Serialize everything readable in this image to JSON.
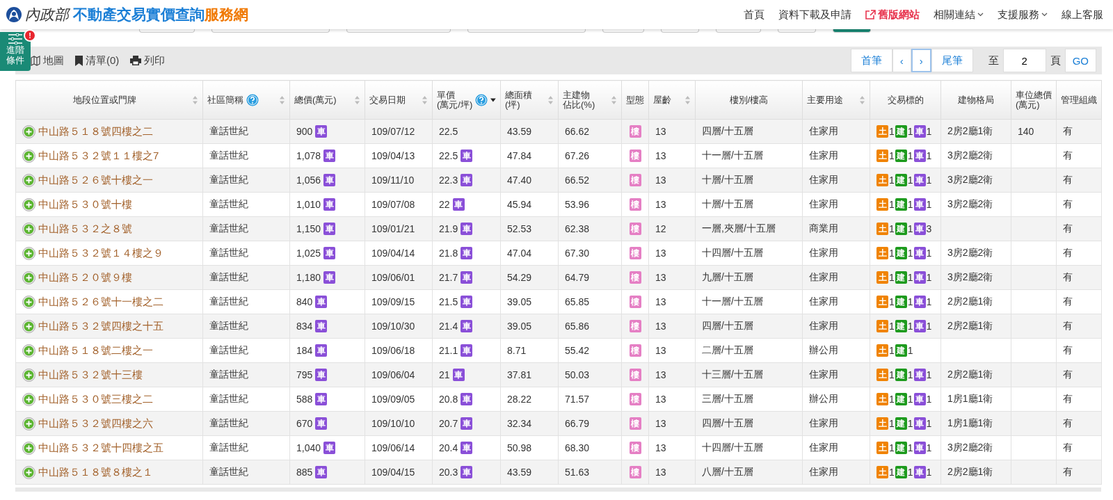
{
  "header": {
    "ministry": "內政部",
    "site_title": "不動產交易實價查詢",
    "site_title_accent": "服務網",
    "nav": [
      {
        "label": "首頁",
        "kind": "plain"
      },
      {
        "label": "資料下載及申請",
        "kind": "plain"
      },
      {
        "label": "舊版網站",
        "kind": "external"
      },
      {
        "label": "相關連結",
        "kind": "dropdown"
      },
      {
        "label": "支援服務",
        "kind": "dropdown"
      },
      {
        "label": "線上客服",
        "kind": "plain"
      }
    ]
  },
  "advanced_tab": {
    "label": "進階條件",
    "alert": "!"
  },
  "toolbar": {
    "actions": [
      {
        "label": "地圖",
        "kind": "map"
      },
      {
        "label": "清單(0)",
        "kind": "bookmark"
      },
      {
        "label": "列印",
        "kind": "print"
      }
    ],
    "pager": {
      "first": "首筆",
      "prev": "‹",
      "next": "›",
      "last": "尾筆",
      "to": "至",
      "page": "2",
      "page_unit": "頁",
      "go": "GO"
    }
  },
  "table": {
    "columns": [
      {
        "label_lines": [
          "地段位置或門牌"
        ],
        "sortable": true,
        "sorted_desc": false,
        "help": false
      },
      {
        "label_lines": [
          "社區簡稱"
        ],
        "sortable": true,
        "sorted_desc": false,
        "help": true
      },
      {
        "label_lines": [
          "總價(萬元)"
        ],
        "sortable": true,
        "sorted_desc": false,
        "help": false
      },
      {
        "label_lines": [
          "交易日期"
        ],
        "sortable": true,
        "sorted_desc": false,
        "help": false
      },
      {
        "label_lines": [
          "單價",
          "(萬元/坪)"
        ],
        "sortable": true,
        "sorted_desc": true,
        "help": true
      },
      {
        "label_lines": [
          "總面積",
          "(坪)"
        ],
        "sortable": true,
        "sorted_desc": false,
        "help": false
      },
      {
        "label_lines": [
          "主建物",
          "佔比(%)"
        ],
        "sortable": true,
        "sorted_desc": false,
        "help": false
      },
      {
        "label_lines": [
          "型態"
        ],
        "sortable": false,
        "help": false
      },
      {
        "label_lines": [
          "屋齡"
        ],
        "sortable": true,
        "sorted_desc": false,
        "help": false
      },
      {
        "label_lines": [
          "樓別/樓高"
        ],
        "sortable": false,
        "help": false
      },
      {
        "label_lines": [
          "主要用途"
        ],
        "sortable": true,
        "sorted_desc": false,
        "help": false
      },
      {
        "label_lines": [
          "交易標的"
        ],
        "sortable": false,
        "help": false
      },
      {
        "label_lines": [
          "建物格局"
        ],
        "sortable": false,
        "help": false
      },
      {
        "label_lines": [
          "車位總價",
          "(萬元)"
        ],
        "sortable": false,
        "help": false
      },
      {
        "label_lines": [
          "管理組織"
        ],
        "sortable": false,
        "help": false
      }
    ],
    "rows": [
      {
        "address": "中山路５１８號四樓之二",
        "community": "童話世紀",
        "price": "900",
        "price_tag": "車",
        "date": "109/07/12",
        "unit": "22.5",
        "area": "43.59",
        "ratio": "66.62",
        "type": "樓",
        "age": "13",
        "floor": "四層/十五層",
        "use": "住家用",
        "targets": [
          {
            "label": "土",
            "count": "1",
            "color": "#f08300"
          },
          {
            "label": "建",
            "count": "1",
            "color": "#1e9b1e"
          },
          {
            "label": "車",
            "count": "1",
            "color": "#8a4fd8"
          }
        ],
        "layout": "2房2廳1衛",
        "parking_price": "140",
        "management": "有"
      },
      {
        "address": "中山路５３２號１１樓之7",
        "community": "童話世紀",
        "price": "1,078",
        "price_tag": "車",
        "date": "109/04/13",
        "unit": "22.5",
        "unit_tag": "車",
        "area": "47.84",
        "ratio": "67.26",
        "type": "樓",
        "age": "13",
        "floor": "十一層/十五層",
        "use": "住家用",
        "targets": [
          {
            "label": "土",
            "count": "1",
            "color": "#f08300"
          },
          {
            "label": "建",
            "count": "1",
            "color": "#1e9b1e"
          },
          {
            "label": "車",
            "count": "1",
            "color": "#8a4fd8"
          }
        ],
        "layout": "3房2廳2衛",
        "management": "有"
      },
      {
        "address": "中山路５２６號十樓之一",
        "community": "童話世紀",
        "price": "1,056",
        "price_tag": "車",
        "date": "109/11/10",
        "unit": "22.3",
        "unit_tag": "車",
        "area": "47.40",
        "ratio": "66.52",
        "type": "樓",
        "age": "13",
        "floor": "十層/十五層",
        "use": "住家用",
        "targets": [
          {
            "label": "土",
            "count": "1",
            "color": "#f08300"
          },
          {
            "label": "建",
            "count": "1",
            "color": "#1e9b1e"
          },
          {
            "label": "車",
            "count": "1",
            "color": "#8a4fd8"
          }
        ],
        "layout": "3房2廳2衛",
        "management": "有"
      },
      {
        "address": "中山路５３０號十樓",
        "community": "童話世紀",
        "price": "1,010",
        "price_tag": "車",
        "date": "109/07/08",
        "unit": "22",
        "unit_tag": "車",
        "area": "45.94",
        "ratio": "53.96",
        "type": "樓",
        "age": "13",
        "floor": "十層/十五層",
        "use": "住家用",
        "targets": [
          {
            "label": "土",
            "count": "1",
            "color": "#f08300"
          },
          {
            "label": "建",
            "count": "1",
            "color": "#1e9b1e"
          },
          {
            "label": "車",
            "count": "1",
            "color": "#8a4fd8"
          }
        ],
        "layout": "3房2廳2衛",
        "management": "有"
      },
      {
        "address": "中山路５３２之８號",
        "community": "童話世紀",
        "price": "1,150",
        "price_tag": "車",
        "date": "109/01/21",
        "unit": "21.9",
        "unit_tag": "車",
        "area": "52.53",
        "ratio": "62.38",
        "type": "樓",
        "age": "12",
        "floor": "一層,夾層/十五層",
        "use": "商業用",
        "targets": [
          {
            "label": "土",
            "count": "1",
            "color": "#f08300"
          },
          {
            "label": "建",
            "count": "1",
            "color": "#1e9b1e"
          },
          {
            "label": "車",
            "count": "3",
            "color": "#8a4fd8"
          }
        ],
        "management": "有"
      },
      {
        "address": "中山路５３２號１４樓之９",
        "community": "童話世紀",
        "price": "1,025",
        "price_tag": "車",
        "date": "109/04/14",
        "unit": "21.8",
        "unit_tag": "車",
        "area": "47.04",
        "ratio": "67.30",
        "type": "樓",
        "age": "13",
        "floor": "十四層/十五層",
        "use": "住家用",
        "targets": [
          {
            "label": "土",
            "count": "1",
            "color": "#f08300"
          },
          {
            "label": "建",
            "count": "1",
            "color": "#1e9b1e"
          },
          {
            "label": "車",
            "count": "1",
            "color": "#8a4fd8"
          }
        ],
        "layout": "3房2廳2衛",
        "management": "有"
      },
      {
        "address": "中山路５２０號９樓",
        "community": "童話世紀",
        "price": "1,180",
        "price_tag": "車",
        "date": "109/06/01",
        "unit": "21.7",
        "unit_tag": "車",
        "area": "54.29",
        "ratio": "64.79",
        "type": "樓",
        "age": "13",
        "floor": "九層/十五層",
        "use": "住家用",
        "targets": [
          {
            "label": "土",
            "count": "1",
            "color": "#f08300"
          },
          {
            "label": "建",
            "count": "1",
            "color": "#1e9b1e"
          },
          {
            "label": "車",
            "count": "1",
            "color": "#8a4fd8"
          }
        ],
        "layout": "3房2廳2衛",
        "management": "有"
      },
      {
        "address": "中山路５２６號十一樓之二",
        "community": "童話世紀",
        "price": "840",
        "price_tag": "車",
        "date": "109/09/15",
        "unit": "21.5",
        "unit_tag": "車",
        "area": "39.05",
        "ratio": "65.85",
        "type": "樓",
        "age": "13",
        "floor": "十一層/十五層",
        "use": "住家用",
        "targets": [
          {
            "label": "土",
            "count": "1",
            "color": "#f08300"
          },
          {
            "label": "建",
            "count": "1",
            "color": "#1e9b1e"
          },
          {
            "label": "車",
            "count": "1",
            "color": "#8a4fd8"
          }
        ],
        "layout": "2房2廳1衛",
        "management": "有"
      },
      {
        "address": "中山路５３２號四樓之十五",
        "community": "童話世紀",
        "price": "834",
        "price_tag": "車",
        "date": "109/10/30",
        "unit": "21.4",
        "unit_tag": "車",
        "area": "39.05",
        "ratio": "65.86",
        "type": "樓",
        "age": "13",
        "floor": "四層/十五層",
        "use": "住家用",
        "targets": [
          {
            "label": "土",
            "count": "1",
            "color": "#f08300"
          },
          {
            "label": "建",
            "count": "1",
            "color": "#1e9b1e"
          },
          {
            "label": "車",
            "count": "1",
            "color": "#8a4fd8"
          }
        ],
        "layout": "2房2廳1衛",
        "management": "有"
      },
      {
        "address": "中山路５１８號二樓之一",
        "community": "童話世紀",
        "price": "184",
        "price_tag": "車",
        "date": "109/06/18",
        "unit": "21.1",
        "unit_tag": "車",
        "area": "8.71",
        "ratio": "55.42",
        "type": "樓",
        "age": "13",
        "floor": "二層/十五層",
        "use": "辦公用",
        "targets": [
          {
            "label": "土",
            "count": "1",
            "color": "#f08300"
          },
          {
            "label": "建",
            "count": "1",
            "color": "#1e9b1e"
          }
        ],
        "management": "有"
      },
      {
        "address": "中山路５３２號十三樓",
        "community": "童話世紀",
        "price": "795",
        "price_tag": "車",
        "date": "109/06/04",
        "unit": "21",
        "unit_tag": "車",
        "area": "37.81",
        "ratio": "50.03",
        "type": "樓",
        "age": "13",
        "floor": "十三層/十五層",
        "use": "住家用",
        "targets": [
          {
            "label": "土",
            "count": "1",
            "color": "#f08300"
          },
          {
            "label": "建",
            "count": "1",
            "color": "#1e9b1e"
          },
          {
            "label": "車",
            "count": "1",
            "color": "#8a4fd8"
          }
        ],
        "layout": "2房2廳1衛",
        "management": "有"
      },
      {
        "address": "中山路５３０號三樓之二",
        "community": "童話世紀",
        "price": "588",
        "price_tag": "車",
        "date": "109/09/05",
        "unit": "20.8",
        "unit_tag": "車",
        "area": "28.22",
        "ratio": "71.57",
        "type": "樓",
        "age": "13",
        "floor": "三層/十五層",
        "use": "辦公用",
        "targets": [
          {
            "label": "土",
            "count": "1",
            "color": "#f08300"
          },
          {
            "label": "建",
            "count": "1",
            "color": "#1e9b1e"
          },
          {
            "label": "車",
            "count": "1",
            "color": "#8a4fd8"
          }
        ],
        "layout": "1房1廳1衛",
        "management": "有"
      },
      {
        "address": "中山路５３２號四樓之六",
        "community": "童話世紀",
        "price": "670",
        "price_tag": "車",
        "date": "109/10/10",
        "unit": "20.7",
        "unit_tag": "車",
        "area": "32.34",
        "ratio": "66.79",
        "type": "樓",
        "age": "13",
        "floor": "四層/十五層",
        "use": "住家用",
        "targets": [
          {
            "label": "土",
            "count": "1",
            "color": "#f08300"
          },
          {
            "label": "建",
            "count": "1",
            "color": "#1e9b1e"
          },
          {
            "label": "車",
            "count": "1",
            "color": "#8a4fd8"
          }
        ],
        "layout": "1房1廳1衛",
        "management": "有"
      },
      {
        "address": "中山路５３２號十四樓之五",
        "community": "童話世紀",
        "price": "1,040",
        "price_tag": "車",
        "date": "109/06/14",
        "unit": "20.4",
        "unit_tag": "車",
        "area": "50.98",
        "ratio": "68.30",
        "type": "樓",
        "age": "13",
        "floor": "十四層/十五層",
        "use": "住家用",
        "targets": [
          {
            "label": "土",
            "count": "1",
            "color": "#f08300"
          },
          {
            "label": "建",
            "count": "1",
            "color": "#1e9b1e"
          },
          {
            "label": "車",
            "count": "1",
            "color": "#8a4fd8"
          }
        ],
        "layout": "3房2廳2衛",
        "management": "有"
      },
      {
        "address": "中山路５１８號８樓之１",
        "community": "童話世紀",
        "price": "885",
        "price_tag": "車",
        "date": "109/04/15",
        "unit": "20.3",
        "unit_tag": "車",
        "area": "43.59",
        "ratio": "51.63",
        "type": "樓",
        "age": "13",
        "floor": "八層/十五層",
        "use": "住家用",
        "targets": [
          {
            "label": "土",
            "count": "1",
            "color": "#f08300"
          },
          {
            "label": "建",
            "count": "1",
            "color": "#1e9b1e"
          },
          {
            "label": "車",
            "count": "1",
            "color": "#8a4fd8"
          }
        ],
        "layout": "2房2廳1衛",
        "management": "有"
      }
    ]
  }
}
